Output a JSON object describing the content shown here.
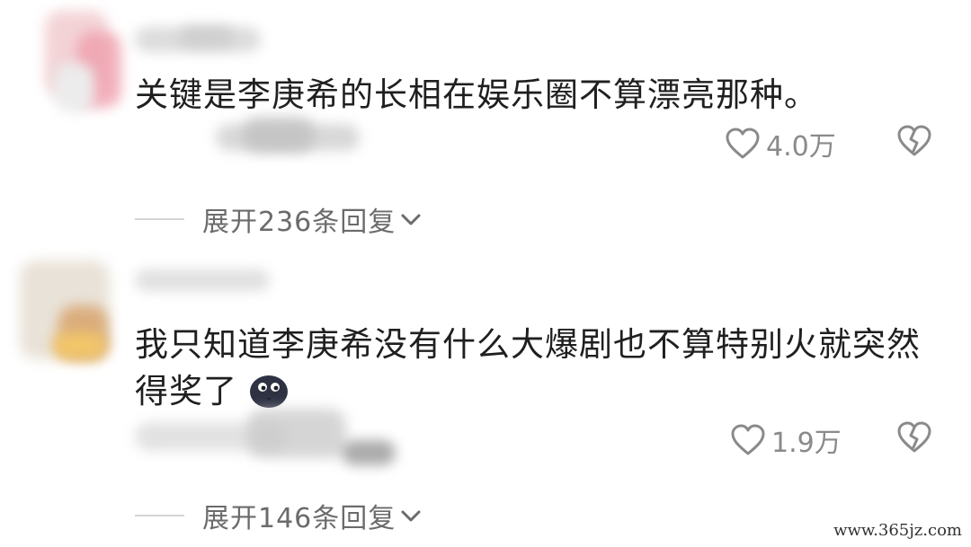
{
  "comments": [
    {
      "text": "关键是李庚希的长相在娱乐圈不算漂亮那种。",
      "like_count": "4.0万",
      "expand_label": "展开236条回复"
    },
    {
      "text": "我只知道李庚希没有什么大爆剧也不算特别火就突然得奖了",
      "like_count": "1.9万",
      "expand_label": "展开146条回复"
    }
  ],
  "icons": {
    "like": "heart-outline-icon",
    "dislike": "broken-heart-icon",
    "expand": "chevron-down-icon",
    "emoji": "dark-face-emoji"
  },
  "watermark": "www.365jz.com",
  "colors": {
    "text": "#1f1f1f",
    "secondary": "#8a8a8a",
    "expand": "#6b6b6b"
  }
}
